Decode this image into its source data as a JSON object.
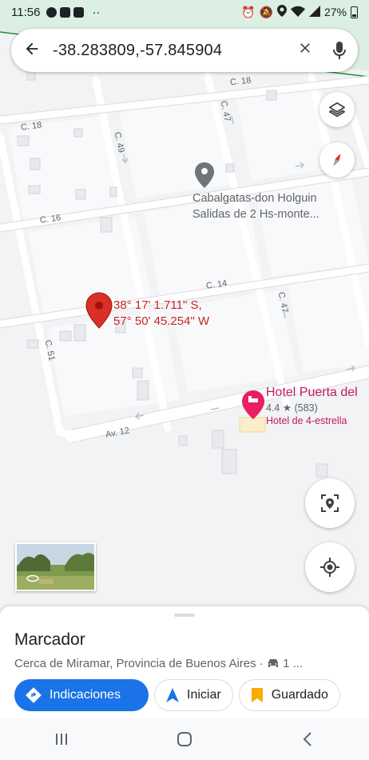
{
  "status_bar": {
    "time": "11:56",
    "dots": "··",
    "battery": "27%"
  },
  "search": {
    "value": "-38.283809,-57.845904",
    "back_icon": "arrow-left-icon",
    "clear_icon": "close-icon",
    "mic_icon": "mic-icon"
  },
  "map": {
    "streets": {
      "c18_top": "C. 18",
      "c18_left": "C. 18",
      "c47_top": "C. 47",
      "c49": "C. 49",
      "c16": "C. 16",
      "c14": "C. 14",
      "c47_mid": "C. 47",
      "c51": "C. 51",
      "av12": "Av. 12"
    },
    "dropped_pin": {
      "lat_text": "38° 17' 1.711\" S,",
      "lon_text": "57° 50' 45.254\" W"
    },
    "poi": {
      "line1": "Cabalgatas-don Holguin",
      "line2": "Salidas de 2 Hs-monte..."
    },
    "hotel": {
      "name": "Hotel Puerta del",
      "rating": "4.4",
      "star": "★",
      "reviews": "(583)",
      "type": "Hotel de 4-estrella"
    }
  },
  "sheet": {
    "title": "Marcador",
    "subtitle": "Cerca de Miramar, Provincia de Buenos Aires · ",
    "subtitle_tail": "1 ...",
    "actions": {
      "directions": "Indicaciones",
      "start": "Iniciar",
      "saved": "Guardado"
    }
  },
  "colors": {
    "accent": "#1a73e8",
    "pin": "#d93025",
    "hotel": "#c2185b",
    "saved_icon": "#f9ab00"
  }
}
